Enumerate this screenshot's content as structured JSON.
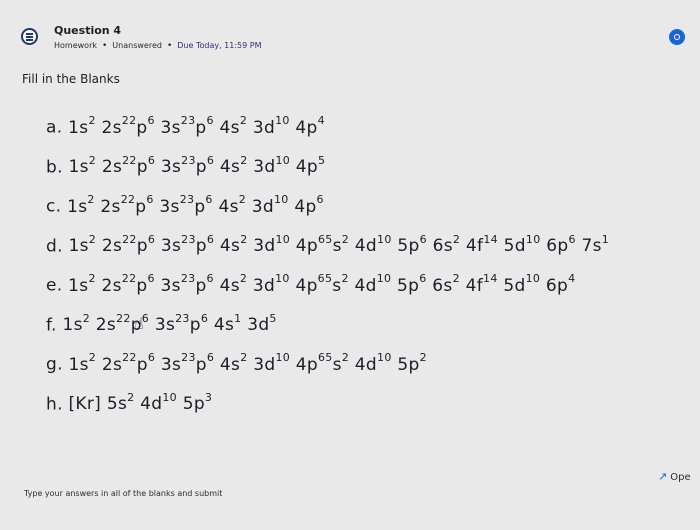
{
  "question": {
    "title": "Question 4",
    "category": "Homework",
    "status": "Unanswered",
    "due": "Due Today, 11:59 PM"
  },
  "instruction": "Fill in the Blanks",
  "answers": [
    {
      "label": "a.",
      "config": "1s2 2s22p6 3s23p6 4s2 3d10 4p4"
    },
    {
      "label": "b.",
      "config": "1s2 2s22p6 3s23p6 4s2 3d10 4p5"
    },
    {
      "label": "c.",
      "config": "1s2 2s22p6 3s23p6 4s2 3d10 4p6"
    },
    {
      "label": "d.",
      "config": "1s2 2s22p6 3s23p6 4s2 3d10 4p65s2 4d10 5p6 6s2 4f14 5d10 6p6 7s1"
    },
    {
      "label": "e.",
      "config": "1s2 2s22p6 3s23p6 4s2 3d10 4p65s2 4d10 5p6 6s2 4f14 5d10 6p4"
    },
    {
      "label": "f.",
      "config": "1s2 2s22p6 3s23p6 4s1 3d5"
    },
    {
      "label": "g.",
      "config": "1s2 2s22p6 3s23p6 4s2 3d10 4p65s2 4d10 5p2"
    },
    {
      "label": "h.",
      "config": "[Kr] 5s2 4d10 5p3"
    }
  ],
  "footer": {
    "instruction": "Type your answers in all of the blanks and submit",
    "open_label": "Ope"
  },
  "icons": {
    "question": "homework-list-icon",
    "status": "status-indicator-icon",
    "cursor": "hand-pointer-icon",
    "open": "open-arrow-icon"
  },
  "colors": {
    "background": "#e9e9ea",
    "accent": "#1b64d8",
    "due": "#3b2a74"
  }
}
